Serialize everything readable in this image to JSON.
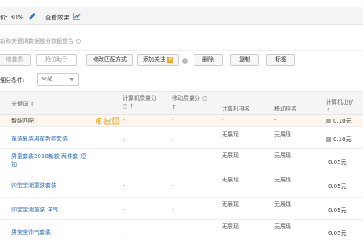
{
  "header": {
    "price_label": "价: 30%",
    "view_effect": "查看效果"
  },
  "notice": {
    "text": "新和关键词数据部分数据重合"
  },
  "toolbar": {
    "first": "增首条",
    "second": "抢位助手",
    "modify_match": "修改匹配方式",
    "add_follow": "添加关注",
    "new_badge": "新",
    "delete": "删除",
    "copy": "复制",
    "tag": "标签"
  },
  "filter": {
    "label": "细分条件:",
    "value": "全部"
  },
  "table": {
    "headers": {
      "keyword": "关键词 ↑",
      "pc_impressions": "计算机质量分",
      "pc_impressions_sub": "↑",
      "mobile_quality": "移动质量分",
      "mobile_quality_sub": "↑",
      "pc_rank": "计算机排名",
      "mobile_rank": "移动排名",
      "pc_bid": "计算机出价",
      "pc_bid_sub": "↑"
    },
    "rows": [
      {
        "keyword": "智能匹配",
        "pc_q": "-",
        "m_q": "-",
        "pc_rank": "-",
        "m_rank": "-",
        "bid": "0.10元"
      },
      {
        "keyword": "童装夏装男童新款套装",
        "pc_q": "-",
        "m_q": "-",
        "pc_rank": "无展现",
        "m_rank": "无展现",
        "bid": "0.10元"
      },
      {
        "keyword": "男童套装2018新款 两件套 短袖",
        "pc_q": "-",
        "m_q": "-",
        "pc_rank": "无展现",
        "m_rank": "无展现",
        "bid": "0.05元"
      },
      {
        "keyword": "帅宝宝潮童装套装",
        "pc_q": "-",
        "m_q": "-",
        "pc_rank": "无展现",
        "m_rank": "无展现",
        "bid": "0.05元"
      },
      {
        "keyword": "帅宝宝潮童装 洋气",
        "pc_q": "-",
        "m_q": "-",
        "pc_rank": "无展现",
        "m_rank": "无展现",
        "bid": "0.05元"
      },
      {
        "keyword": "男宝宝帅气套装",
        "pc_q": "-",
        "m_q": "-",
        "pc_rank": "无展现",
        "m_rank": "无展现",
        "bid": "0.05元"
      }
    ]
  },
  "colors": {
    "link": "#2f6fbf",
    "highlight_row": "#fdf6ee",
    "icon_orange": "#f5a623"
  }
}
